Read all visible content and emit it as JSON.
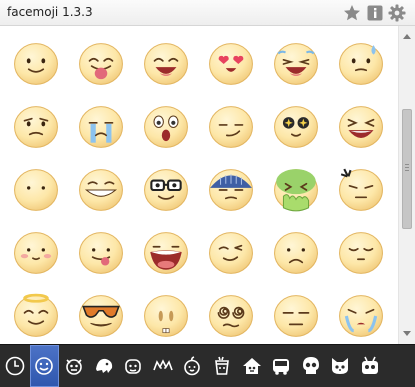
{
  "app": {
    "title": "facemoji 1.3.3"
  },
  "header": {
    "icons": [
      {
        "name": "star-icon",
        "label": "favorite"
      },
      {
        "name": "info-icon",
        "label": "info"
      },
      {
        "name": "gear-icon",
        "label": "settings"
      }
    ]
  },
  "colors": {
    "face": "#fde7a8",
    "face_edge": "#e3b661",
    "tabbar_bg": "#2b2b2b",
    "active_tab": "#3a62bd"
  },
  "emoji_grid": {
    "rows": [
      [
        "smile",
        "tongue-out",
        "big-grin",
        "heart-eyes",
        "laugh-tears",
        "sweat"
      ],
      [
        "worried",
        "crying",
        "shocked",
        "smirk",
        "sparkle-eyes",
        "squint-laugh"
      ],
      [
        "blank",
        "grin-teeth",
        "nerd-glasses",
        "scared-blue",
        "vomit-green",
        "angry"
      ],
      [
        "blush",
        "tongue-side",
        "wide-mouth",
        "wink",
        "sad-frown",
        "content"
      ],
      [
        "angel",
        "sunglasses",
        "bunny",
        "dizzy",
        "neutral",
        "sobbing"
      ]
    ]
  },
  "scrollbar": {
    "position": 0.4
  },
  "tabs": {
    "active": 1,
    "items": [
      "clock-icon",
      "smiley-icon",
      "monster-icon",
      "ghost-icon",
      "creature-icon",
      "bat-icon",
      "apple-icon",
      "cup-icon",
      "house-icon",
      "bus-icon",
      "skull-icon",
      "cat-icon",
      "robot-icon"
    ]
  }
}
